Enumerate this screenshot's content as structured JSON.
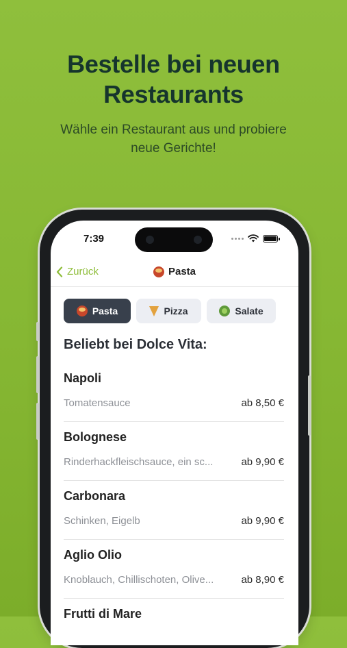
{
  "promo": {
    "headline_line1": "Bestelle bei neuen",
    "headline_line2": "Restaurants",
    "subline_line1": "Wähle ein Restaurant aus und probiere",
    "subline_line2": "neue Gerichte!"
  },
  "status_bar": {
    "time": "7:39"
  },
  "navbar": {
    "back_label": "Zurück",
    "title": "Pasta",
    "title_icon": "pasta-icon"
  },
  "categories": [
    {
      "label": "Pasta",
      "icon": "pasta-icon",
      "active": true
    },
    {
      "label": "Pizza",
      "icon": "pizza-icon",
      "active": false
    },
    {
      "label": "Salate",
      "icon": "salad-icon",
      "active": false
    }
  ],
  "section_title": "Beliebt bei Dolce Vita:",
  "menu": [
    {
      "name": "Napoli",
      "description": "Tomatensauce",
      "price": "ab 8,50 €"
    },
    {
      "name": "Bolognese",
      "description": "Rinderhackfleischsauce, ein sc...",
      "price": "ab 9,90 €"
    },
    {
      "name": "Carbonara",
      "description": "Schinken, Eigelb",
      "price": "ab 9,90 €"
    },
    {
      "name": "Aglio Olio",
      "description": "Knoblauch, Chillischoten, Olive...",
      "price": "ab 8,90 €"
    },
    {
      "name": "Frutti di Mare",
      "description": "",
      "price": ""
    }
  ],
  "colors": {
    "background": "#86b733",
    "accent": "#8fbd3a",
    "headline": "#16352d",
    "active_chip": "#38404c"
  }
}
